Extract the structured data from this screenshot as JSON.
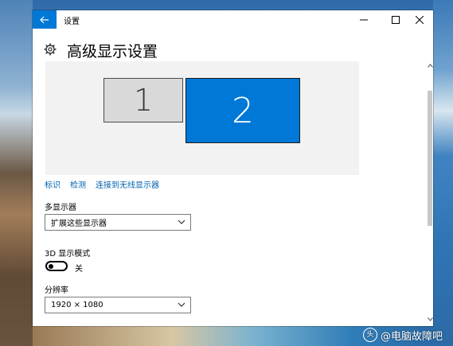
{
  "window": {
    "title": "设置",
    "page_title": "高级显示设置"
  },
  "preview": {
    "monitors": [
      {
        "label": "1",
        "selected": false
      },
      {
        "label": "2",
        "selected": true
      }
    ]
  },
  "links": {
    "identify": "标识",
    "detect": "检测",
    "connect_wireless": "连接到无线显示器"
  },
  "multiple_displays": {
    "label": "多显示器",
    "value": "扩展这些显示器"
  },
  "mode_3d": {
    "label": "3D 显示模式",
    "state_text": "关",
    "on": false
  },
  "resolution": {
    "label": "分辨率",
    "value": "1920 × 1080"
  },
  "watermark": {
    "text": "@电脑故障吧",
    "badge": "头"
  },
  "colors": {
    "accent": "#0078d7",
    "link": "#0063b1"
  },
  "icons": [
    "back-arrow-icon",
    "minimize-icon",
    "maximize-icon",
    "close-icon",
    "gear-icon",
    "chevron-down-icon",
    "scroll-up-icon",
    "scroll-down-icon"
  ]
}
